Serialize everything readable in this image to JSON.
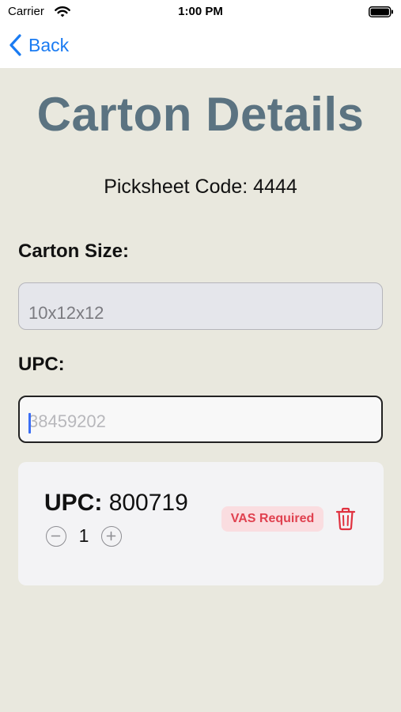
{
  "status_bar": {
    "carrier": "Carrier",
    "time": "1:00 PM"
  },
  "nav": {
    "back_label": "Back"
  },
  "page": {
    "title": "Carton Details",
    "picksheet_code": "Picksheet Code: 4444"
  },
  "form": {
    "carton_size_label": "Carton Size:",
    "carton_size_value": "10x12x12",
    "upc_label": "UPC:",
    "upc_placeholder": "38459202"
  },
  "items": [
    {
      "upc_key": "UPC:",
      "upc_value": "800719",
      "quantity": "1",
      "badge": "VAS Required"
    }
  ],
  "colors": {
    "background": "#e9e8de",
    "title": "#5b7381",
    "accent": "#1a7bf2",
    "badge_text": "#e0414f",
    "badge_bg": "#fadde0",
    "delete": "#e0313f"
  },
  "icons": {
    "back": "chevron-left-icon",
    "decrement": "minus-circle-icon",
    "increment": "plus-circle-icon",
    "delete": "trash-icon",
    "wifi": "wifi-icon",
    "battery": "battery-icon"
  }
}
